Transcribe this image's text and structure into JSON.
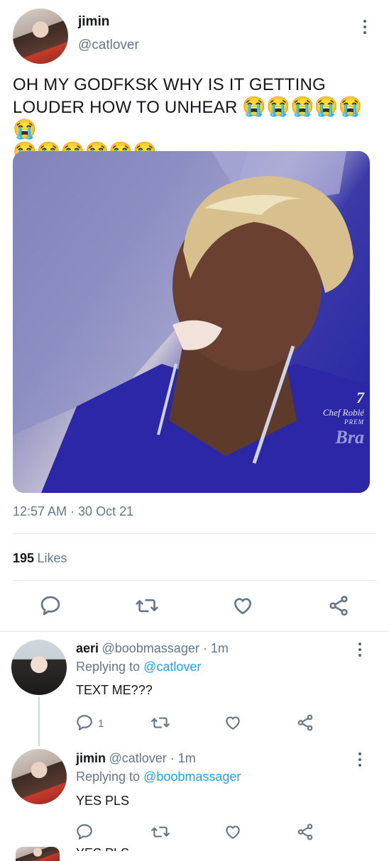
{
  "main_tweet": {
    "author_name": "jimin",
    "author_handle": "@catlover",
    "text_line1": "OH MY GODFKSK WHY IS IT GETTING",
    "text_line2": "LOUDER HOW TO UNHEAR",
    "emoji_line2": "😭😭😭😭😭😭",
    "emoji_line3": "😭😭😭😭😭😭",
    "media_watermark_1": "7",
    "media_watermark_2": "Chef Roblé",
    "media_watermark_3": "PREM",
    "media_watermark_4": "Bra",
    "timestamp": "12:57 AM · 30 Oct 21",
    "likes_count": "195",
    "likes_label": "Likes"
  },
  "replies": [
    {
      "name": "aeri",
      "handle": "@boobmassager · 1m",
      "replying_prefix": "Replying to",
      "replying_to": "@catlover",
      "text": "TEXT ME???",
      "reply_count": "1"
    },
    {
      "name": "jimin",
      "handle": "@catlover · 1m",
      "replying_prefix": "Replying to",
      "replying_to": "@boobmassager",
      "text": "YES PLS",
      "reply_count": ""
    }
  ],
  "partial_next": {
    "text": "YES PLS"
  },
  "icons": {
    "reply": "reply-icon",
    "retweet": "retweet-icon",
    "like": "heart-icon",
    "share": "share-icon",
    "more": "more-vertical-icon"
  },
  "colors": {
    "link": "#1da1f2",
    "secondary_text": "#657786",
    "divider": "#e1e8ed"
  }
}
